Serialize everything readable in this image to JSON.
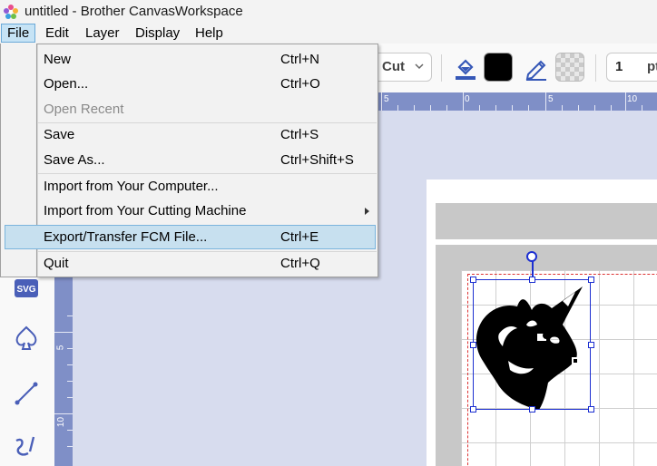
{
  "window": {
    "title": "untitled - Brother CanvasWorkspace"
  },
  "menubar": {
    "items": [
      {
        "label": "File",
        "active": true
      },
      {
        "label": "Edit"
      },
      {
        "label": "Layer"
      },
      {
        "label": "Display"
      },
      {
        "label": "Help"
      }
    ]
  },
  "toolbar": {
    "mode_select": "Cut",
    "fill_color": "#000000",
    "stroke_width_value": "1",
    "stroke_width_unit": "pt"
  },
  "file_menu": {
    "items": [
      {
        "label": "New",
        "shortcut": "Ctrl+N"
      },
      {
        "label": "Open...",
        "shortcut": "Ctrl+O"
      },
      {
        "label": "Open Recent",
        "shortcut": "",
        "disabled": true
      },
      {
        "label": "Save",
        "shortcut": "Ctrl+S"
      },
      {
        "label": "Save As...",
        "shortcut": "Ctrl+Shift+S"
      },
      {
        "label": "Import from Your Computer...",
        "shortcut": ""
      },
      {
        "label": "Import from Your Cutting Machine",
        "shortcut": "",
        "submenu": true
      },
      {
        "label": "Export/Transfer FCM File...",
        "shortcut": "Ctrl+E",
        "highlighted": true
      },
      {
        "label": "Quit",
        "shortcut": "Ctrl+Q"
      }
    ]
  },
  "ruler": {
    "top_labels": [
      "5",
      "0",
      "5",
      "10"
    ],
    "left_labels": [
      "5",
      "10"
    ]
  },
  "left_tools": [
    "svg-import",
    "shapes",
    "line",
    "freehand"
  ],
  "left_tools_labels": {
    "svg": "SVG"
  },
  "colors": {
    "accent": "#5565b8",
    "selection": "#1c2fd1",
    "menu_highlight": "#c7e0ef"
  }
}
